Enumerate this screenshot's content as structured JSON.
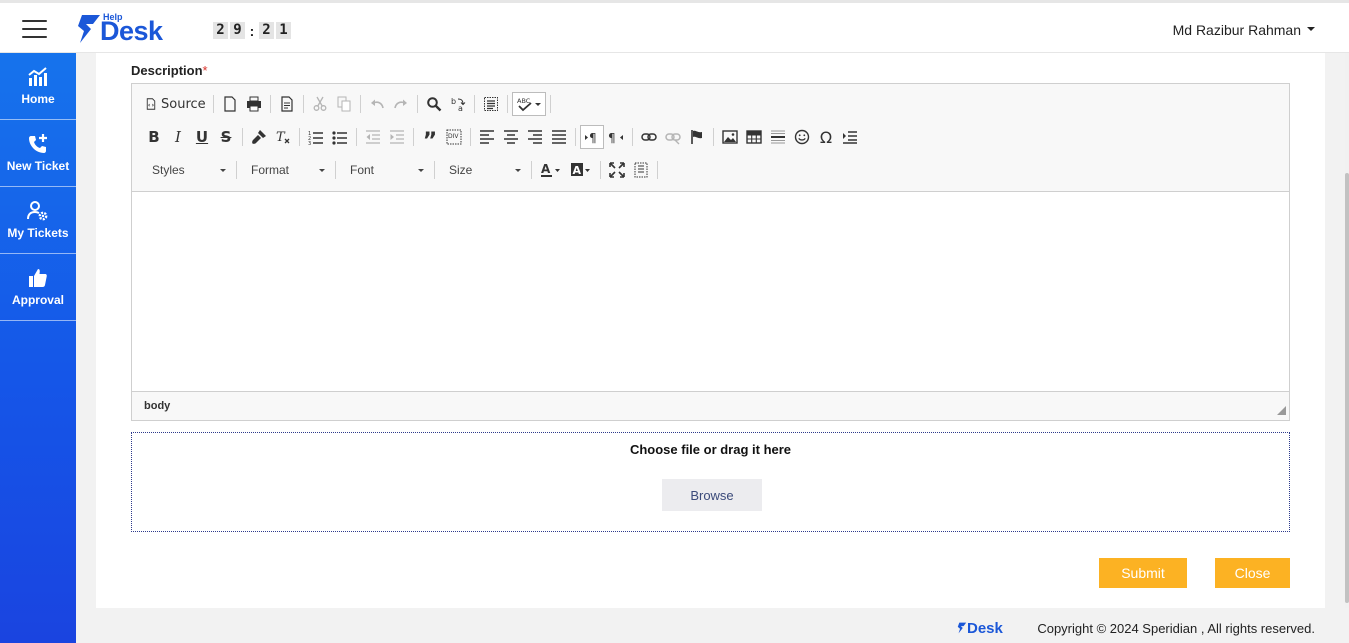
{
  "header": {
    "logo_small": "Help",
    "logo_main": "Desk",
    "timer": [
      "2",
      "9",
      ":",
      "2",
      "1"
    ],
    "user_name": "Md Razibur Rahman"
  },
  "sidebar": {
    "items": [
      {
        "label": "Home",
        "icon": "chart-icon"
      },
      {
        "label": "New Ticket",
        "icon": "phone-plus-icon"
      },
      {
        "label": "My Tickets",
        "icon": "user-gear-icon"
      },
      {
        "label": "Approval",
        "icon": "thumbs-up-icon"
      }
    ]
  },
  "form": {
    "description_label": "Description",
    "required_mark": "*",
    "editor": {
      "source_label": "Source",
      "combos": {
        "styles": "Styles",
        "format": "Format",
        "font": "Font",
        "size": "Size"
      },
      "path": "body"
    },
    "dropzone": {
      "text": "Choose file or drag it here",
      "browse_label": "Browse"
    },
    "submit_label": "Submit",
    "close_label": "Close"
  },
  "footer": {
    "logo": "Desk",
    "copyright": "Copyright © 2024 Speridian , All rights reserved."
  },
  "colors": {
    "accent_blue": "#1b57d8",
    "button_orange": "#fcb223",
    "required_red": "#d9332b"
  }
}
